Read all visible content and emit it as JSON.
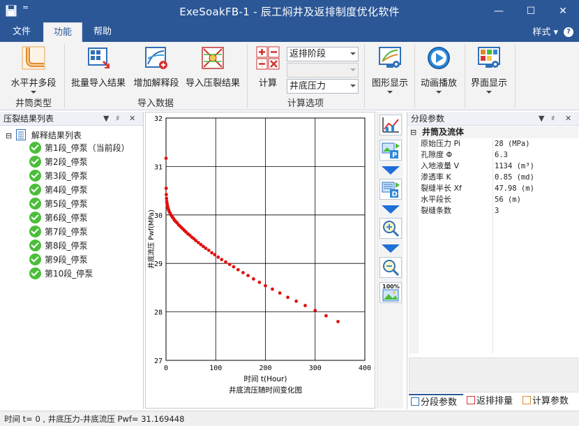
{
  "window": {
    "title": "ExeSoakFB-1 - 辰工焖井及返排制度优化软件",
    "quick_access": "≂",
    "controls": {
      "minimize": "—",
      "maximize": "☐",
      "close": "✕"
    }
  },
  "menu": {
    "items": [
      "文件",
      "功能",
      "帮助"
    ],
    "active": "功能",
    "style_label": "样式",
    "style_arrow": "▾",
    "help_glyph": "?"
  },
  "ribbon": {
    "groups": {
      "wellbore": {
        "label": "井筒类型",
        "buttons": [
          {
            "label": "水平井多段",
            "icon": "horizontal-well-icon",
            "dropdown": true
          }
        ]
      },
      "import": {
        "label": "导入数据",
        "buttons": [
          {
            "label": "批量导入结果",
            "icon": "batch-import-icon"
          },
          {
            "label": "增加解释段",
            "icon": "add-segment-icon"
          },
          {
            "label": "导入压裂结果",
            "icon": "import-frac-icon"
          }
        ]
      },
      "calc": {
        "label": "计算选项",
        "buttons": [
          {
            "label": "计算",
            "icon": "calculator-icon"
          }
        ],
        "combos": [
          {
            "value": "返排阶段",
            "disabled": false
          },
          {
            "value": "",
            "disabled": true
          },
          {
            "value": "井底压力",
            "disabled": false
          }
        ]
      },
      "view": {
        "buttons": [
          {
            "label": "图形显示",
            "icon": "graph-display-icon",
            "dropdown": true
          },
          {
            "label": "动画播放",
            "icon": "animation-play-icon",
            "dropdown": true
          },
          {
            "label": "界面显示",
            "icon": "interface-display-icon",
            "dropdown": true
          }
        ]
      }
    }
  },
  "left_panel": {
    "title": "压裂结果列表",
    "controls": {
      "dropdown": "▼",
      "pin": "♯",
      "close": "✕"
    },
    "tree": {
      "expander": "⊟",
      "root": "解释结果列表",
      "items": [
        "第1段_停泵（当前段）",
        "第2段_停泵",
        "第3段_停泵",
        "第4段_停泵",
        "第5段_停泵",
        "第6段_停泵",
        "第7段_停泵",
        "第8段_停泵",
        "第9段_停泵",
        "第10段_停泵"
      ]
    }
  },
  "chart_data": {
    "type": "scatter",
    "title": "井底流压随时间变化图",
    "xlabel": "时间  t(Hour)",
    "ylabel": "井底流压  Pwf(MPa)",
    "xlim": [
      0,
      400
    ],
    "ylim": [
      27,
      32
    ],
    "xticks": [
      0,
      100,
      200,
      300,
      400
    ],
    "yticks": [
      27,
      28,
      29,
      30,
      31,
      32
    ],
    "grid": true,
    "color": "#e01010",
    "x": [
      0,
      0.3,
      0.6,
      1,
      1.5,
      2,
      2.5,
      3,
      4,
      5,
      6,
      8,
      10,
      12,
      14,
      16,
      18,
      20,
      22,
      25,
      28,
      31,
      34,
      37,
      40,
      44,
      48,
      52,
      56,
      60,
      65,
      70,
      75,
      80,
      86,
      92,
      98,
      105,
      112,
      120,
      128,
      136,
      145,
      155,
      165,
      176,
      188,
      200,
      214,
      229,
      245,
      262,
      280,
      300,
      322,
      346
    ],
    "y": [
      31.169,
      30.55,
      30.42,
      30.34,
      30.28,
      30.24,
      30.21,
      30.18,
      30.14,
      30.11,
      30.08,
      30.04,
      30.0,
      29.97,
      29.94,
      29.91,
      29.88,
      29.86,
      29.84,
      29.8,
      29.77,
      29.74,
      29.71,
      29.68,
      29.65,
      29.61,
      29.58,
      29.54,
      29.51,
      29.47,
      29.43,
      29.39,
      29.35,
      29.31,
      29.27,
      29.22,
      29.18,
      29.13,
      29.08,
      29.03,
      28.98,
      28.93,
      28.87,
      28.81,
      28.75,
      28.68,
      28.61,
      28.54,
      28.47,
      28.39,
      28.3,
      28.22,
      28.13,
      28.03,
      27.92,
      27.8
    ]
  },
  "right_panel": {
    "title": "分段参数",
    "controls": {
      "dropdown": "▼",
      "pin": "♯",
      "close": "✕"
    },
    "expander": "⊟",
    "category": "井筒及流体",
    "rows": [
      {
        "key": "原始压力 Pi",
        "value": "28 (MPa)"
      },
      {
        "key": "孔隙度 Φ",
        "value": "6.3"
      },
      {
        "key": "入地液量 V",
        "value": "1134 (m³)"
      },
      {
        "key": "渗透率 K",
        "value": "0.85 (md)"
      },
      {
        "key": "裂缝半长 Xf",
        "value": "47.98 (m)"
      },
      {
        "key": "水平段长",
        "value": "56 (m)"
      },
      {
        "key": "裂缝条数",
        "value": "3"
      }
    ],
    "bottom_tabs": [
      "分段参数",
      "返排排量",
      "计算参数"
    ]
  },
  "status": {
    "text": "时间 t= 0 , 井底压力-井底流压 Pwf= 31.169448"
  }
}
